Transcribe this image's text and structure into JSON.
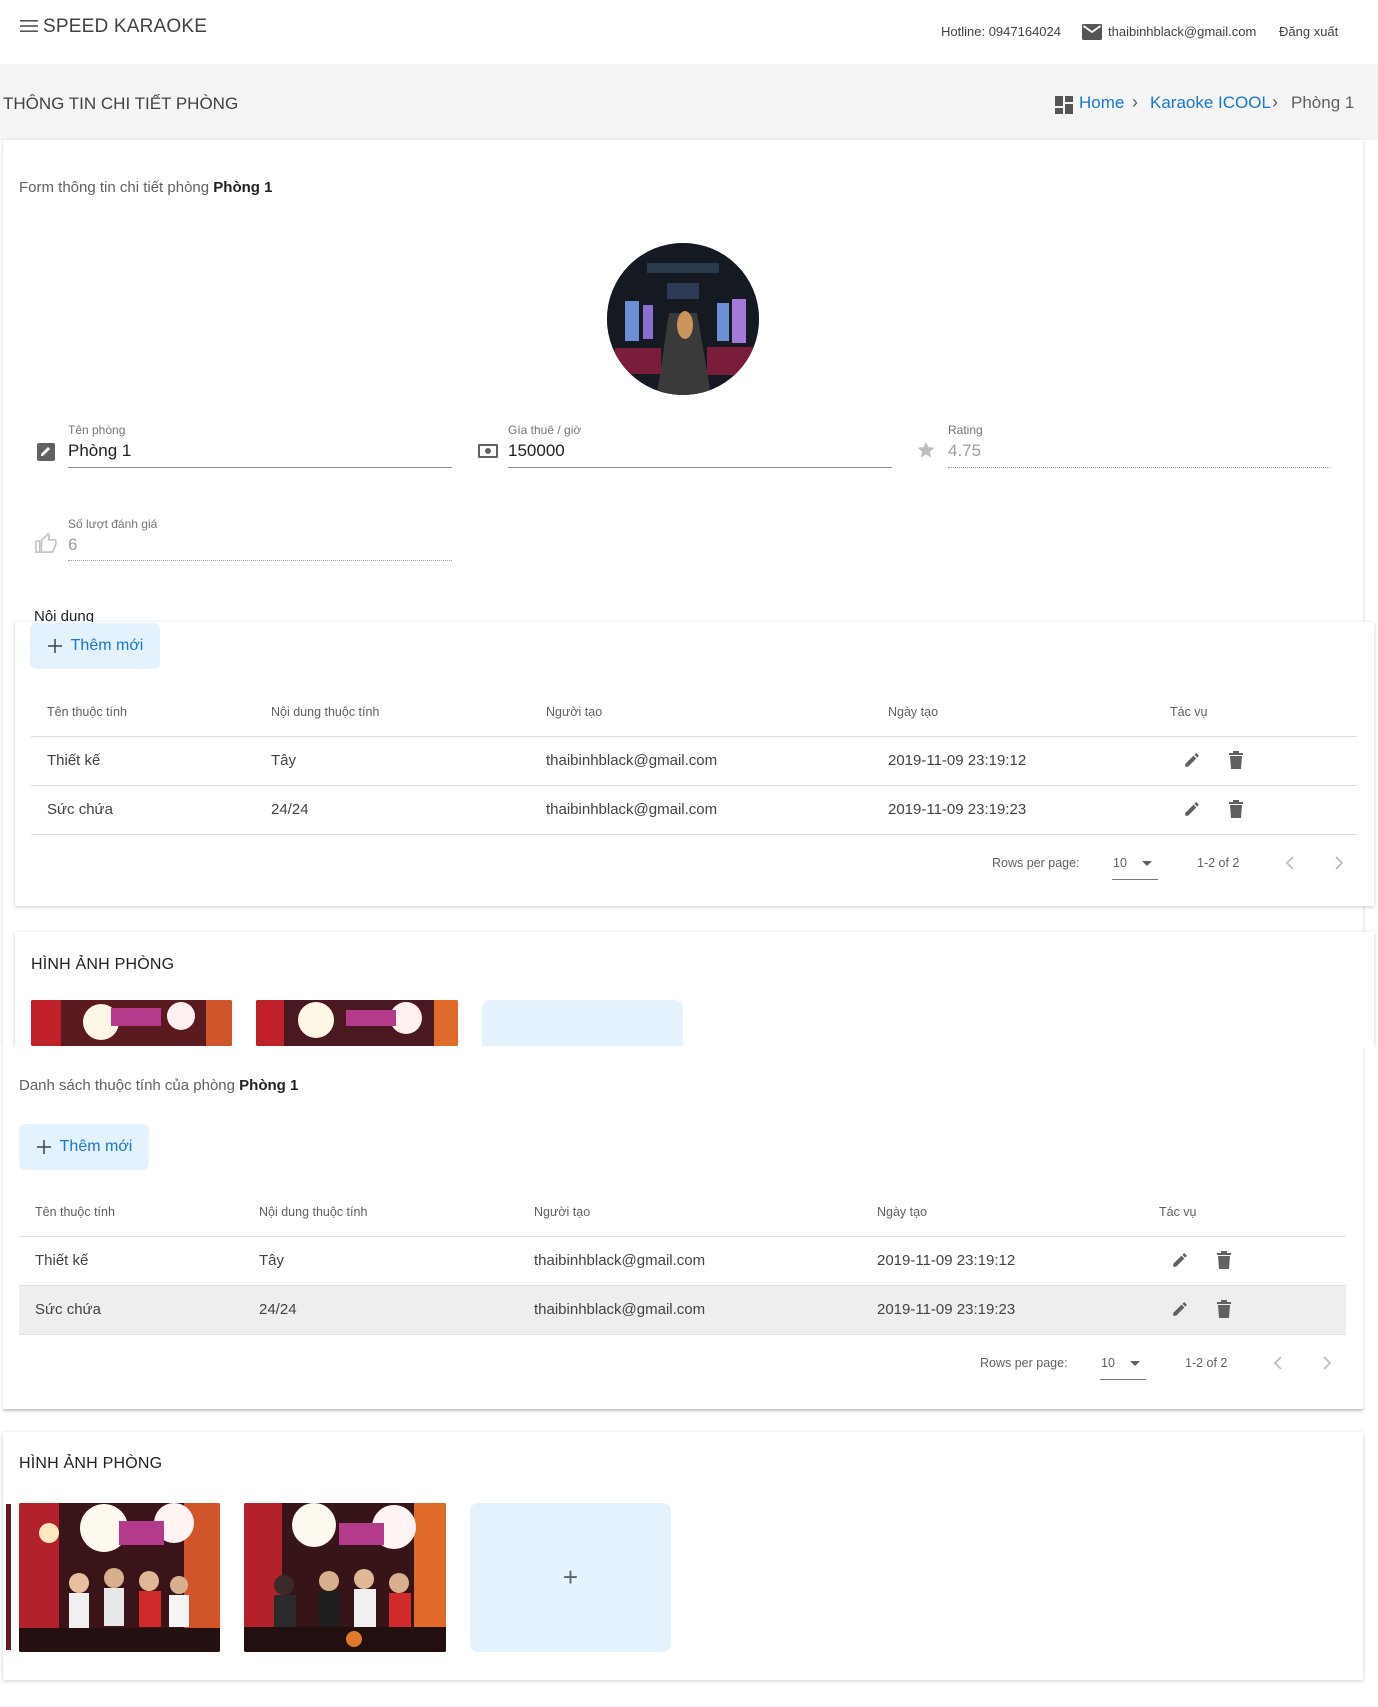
{
  "header": {
    "app_title": "SPEED KARAOKE",
    "hotline": "Hotline: 0947164024",
    "email": "thaibinhblack@gmail.com",
    "logout": "Đăng xuất"
  },
  "subheader": {
    "page_title": "THÔNG TIN CHI TIẾT PHÒNG",
    "breadcrumb": {
      "home": "Home",
      "parent": "Karaoke ICOOL",
      "current": "Phòng 1"
    }
  },
  "form": {
    "title_prefix": "Form thông tin chi tiết phòng",
    "room_name": "Phòng 1",
    "fields": {
      "name": {
        "label": "Tên phòng",
        "value": "Phòng 1"
      },
      "price": {
        "label": "Gía thuê / giờ",
        "value": "150000"
      },
      "rating": {
        "label": "Rating",
        "value": "4.75"
      },
      "votes": {
        "label": "Số lượt đánh giá",
        "value": "6"
      }
    },
    "content_label": "Nội dung"
  },
  "attributes_panel": {
    "title_prefix": "Danh sách thuộc tính của phòng",
    "room_name": "Phòng 1",
    "add_label": "Thêm mới",
    "columns": [
      "Tên thuộc tính",
      "Nội dung thuộc tính",
      "Người tạo",
      "Ngày tạo",
      "Tác vụ"
    ],
    "rows": [
      {
        "name": "Thiết kế",
        "content": "Tây",
        "creator": "thaibinhblack@gmail.com",
        "created": "2019-11-09 23:19:12"
      },
      {
        "name": "Sức chứa",
        "content": "24/24",
        "creator": "thaibinhblack@gmail.com",
        "created": "2019-11-09 23:19:23"
      }
    ],
    "footer": {
      "rows_per_page_label": "Rows per page:",
      "rows_per_page": "10",
      "range": "1-2 of 2"
    }
  },
  "images_section": {
    "title": "HÌNH ẢNH PHÒNG",
    "add_label": "+"
  },
  "icons": {
    "menu": "menu-icon",
    "mail": "mail-icon",
    "breadcrumb_home": "dashboard-icon",
    "edit": "pencil-icon",
    "delete": "trash-icon",
    "price": "cash-icon",
    "rating": "star-icon",
    "votes": "thumb-up-icon"
  },
  "colors": {
    "link": "#1976d2",
    "button_bg": "#e3f2fd"
  }
}
